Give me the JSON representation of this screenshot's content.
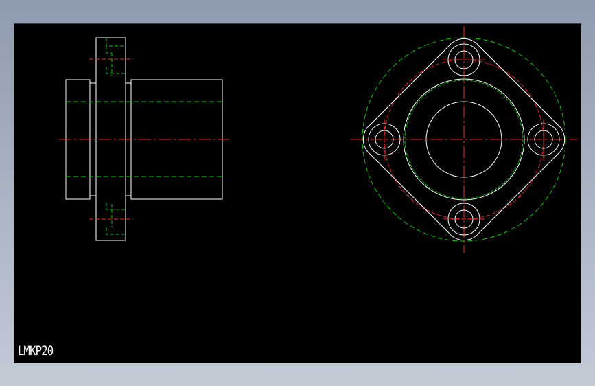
{
  "drawing": {
    "label": "LMKP20",
    "colors": {
      "background": "#000000",
      "outline": "#ffffff",
      "hidden": "#00d000",
      "center": "#ff2020"
    }
  }
}
